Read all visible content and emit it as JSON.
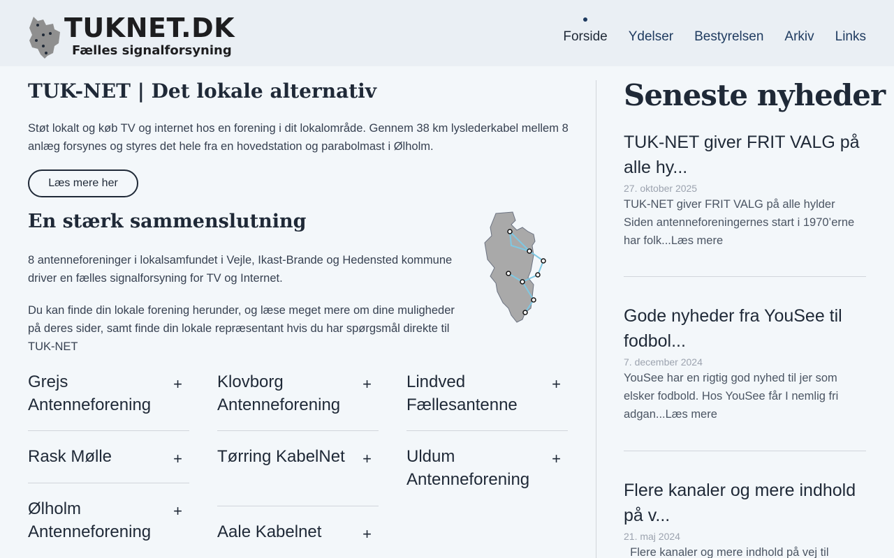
{
  "header": {
    "logo_title": "TUKNET.DK",
    "logo_subtitle": "Fælles signalforsyning",
    "nav": [
      {
        "label": "Forside",
        "active": true
      },
      {
        "label": "Ydelser"
      },
      {
        "label": "Bestyrelsen"
      },
      {
        "label": "Arkiv"
      },
      {
        "label": "Links"
      }
    ]
  },
  "main": {
    "title": "TUK-NET | Det lokale alternativ",
    "intro": "Støt lokalt og køb TV og internet hos en forening i dit lokalområde. Gennem 38 km lyslederkabel mellem 8 anlæg forsynes og styres det hele fra en hovedstation og parabolmast i Ølholm.",
    "button": "Læs mere her",
    "section_title": "En stærk sammenslutning",
    "para1": "8 antenneforeninger i lokalsamfundet i Vejle, Ikast-Brande og Hedensted kommune driver en fælles signalforsyning for TV og Internet.",
    "para2": "Du kan finde din lokale forening herunder, og læse meget mere om dine muligheder på deres sider, samt finde din lokale repræsentant hvis du har spørgsmål direkte til TUK-NET",
    "associations": [
      "Grejs Antenneforening",
      "Klovborg Antenneforening",
      "Lindved Fællesantenne",
      "Rask Mølle",
      "Tørring KabelNet",
      "Uldum Antenneforening",
      "Ølholm Antenneforening",
      "Aale Kabelnet"
    ],
    "plus_glyph": "+"
  },
  "sidebar": {
    "title": "Seneste nyheder",
    "news": [
      {
        "title": "TUK-NET giver FRIT VALG på alle hy...",
        "date": "27. oktober 2025",
        "text": "TUK-NET giver FRIT VALG på alle hylder Siden antenneforeningernes start i 1970’erne har folk...Læs mere"
      },
      {
        "title": "Gode nyheder fra YouSee til fodbol...",
        "date": "7. december 2024",
        "text": "YouSee har en rigtig god nyhed til jer som elsker fodbold. Hos YouSee får I nemlig fri adgan...Læs mere"
      },
      {
        "title": "Flere kanaler og mere indhold på v...",
        "date": "21. maj 2024",
        "text": "  Flere kanaler og mere indhold på vej til"
      }
    ]
  },
  "colors": {
    "background": "#f3f7fa",
    "header": "#eaeff4",
    "text": "#1f2937",
    "nav": "#1e3a5f",
    "map_fill": "#a9a9a9",
    "map_line": "#7ec8e3"
  }
}
